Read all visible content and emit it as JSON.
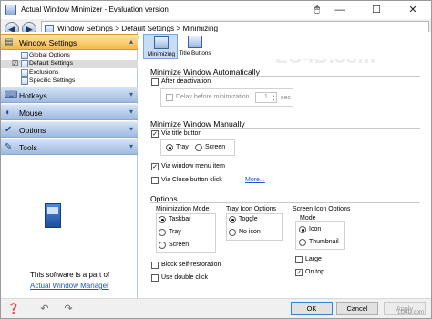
{
  "window": {
    "title": "Actual Window Minimizer - Evaluation version",
    "minimize_glyph": "—",
    "maximize_glyph": "☐",
    "close_glyph": "✕",
    "mouse_glyph": "🖱"
  },
  "nav": {
    "back_glyph": "◀",
    "forward_glyph": "▶",
    "breadcrumb": "Window Settings > Default Settings > Minimizing"
  },
  "sidebar": {
    "sections": [
      {
        "label": "Window Settings",
        "icon": "window-settings-icon",
        "glyph": "▤",
        "chev": "▴"
      },
      {
        "label": "Hotkeys",
        "icon": "keyboard-icon",
        "glyph": "⌨",
        "chev": "▾"
      },
      {
        "label": "Mouse",
        "icon": "mouse-icon",
        "glyph": "◖",
        "chev": "▾"
      },
      {
        "label": "Options",
        "icon": "options-icon",
        "glyph": "✔",
        "chev": "▾"
      },
      {
        "label": "Tools",
        "icon": "tools-icon",
        "glyph": "✎",
        "chev": "▾"
      }
    ],
    "items": [
      {
        "label": "Global Options",
        "checked": false
      },
      {
        "label": "Default Settings",
        "checked": true
      },
      {
        "label": "Exclusions",
        "checked": false
      },
      {
        "label": "Specific Settings",
        "checked": false
      }
    ],
    "check_glyph": "☑",
    "promo_text": "This software is a part of",
    "promo_link": "Actual Window Manager"
  },
  "tabs": [
    {
      "label": "Minimizing",
      "icon": "minimizing-tab-icon"
    },
    {
      "label": "Title Buttons",
      "icon": "title-buttons-tab-icon"
    }
  ],
  "content": {
    "auto": {
      "heading": "Minimize Window Automatically",
      "after_deactivation": "After deactivation",
      "delay_label": "Delay before minimization",
      "delay_value": "1",
      "delay_unit": "sec"
    },
    "manual": {
      "heading": "Minimize Window Manually",
      "via_title_button": "Via title button",
      "tray": "Tray",
      "screen": "Screen",
      "via_menu_item": "Via window menu item",
      "via_close_button": "Via Close button click",
      "more_link": "More..."
    },
    "options": {
      "heading": "Options",
      "minimization_mode": {
        "label": "Minimization Mode",
        "items": [
          "Taskbar",
          "Tray",
          "Screen"
        ],
        "selected": 0
      },
      "tray_icon_options": {
        "label": "Tray Icon Options",
        "items": [
          "Toggle",
          "No icon"
        ],
        "selected": 0
      },
      "screen_icon_options": {
        "label": "Screen Icon Options",
        "mode_label": "Mode",
        "items": [
          "Icon",
          "Thumbnail"
        ],
        "selected": 0,
        "large": "Large",
        "on_top": "On top"
      },
      "block_self_restoration": "Block self-restoration",
      "use_double_click": "Use double click"
    }
  },
  "footer": {
    "ok": "OK",
    "cancel": "Cancel",
    "apply": "Apply",
    "help_glyph": "❓",
    "back_glyph": "↶",
    "forward_glyph": "↷",
    "credit": "LO4D.com"
  },
  "checkbox_glyph": "✓",
  "watermark": "LO4D.com"
}
